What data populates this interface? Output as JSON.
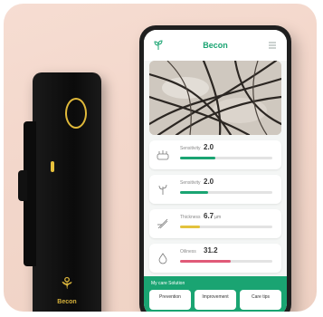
{
  "colors": {
    "accent": "#1aa472",
    "device_gold": "#e0b93a",
    "background": "#f3d7cb"
  },
  "device": {
    "brand": "Becon",
    "logo_icon": "sprout-icon"
  },
  "app": {
    "title": "Becon",
    "left_icon": "sprout-icon",
    "right_icon": "menu-icon",
    "metrics": [
      {
        "label": "Sensitivity",
        "value": "2.0",
        "unit": "",
        "level": 0.38,
        "color": "#1aa472",
        "scale": [
          "",
          "",
          ""
        ]
      },
      {
        "label": "Sensitivity",
        "value": "2.0",
        "unit": "",
        "level": 0.3,
        "color": "#1aa472",
        "scale": [
          "",
          "",
          ""
        ]
      },
      {
        "label": "Thickness",
        "value": "6.7",
        "unit": "µm",
        "level": 0.22,
        "color": "#e3c23c",
        "scale": [
          "",
          "",
          ""
        ]
      },
      {
        "label": "Oiliness",
        "value": "31.2",
        "unit": "",
        "level": 0.55,
        "color": "#e05a78",
        "scale": [
          "",
          "",
          ""
        ]
      }
    ],
    "recommend": {
      "title": "My care Solution",
      "buttons": [
        "Prevention",
        "Improvement",
        "Care tips"
      ]
    }
  }
}
